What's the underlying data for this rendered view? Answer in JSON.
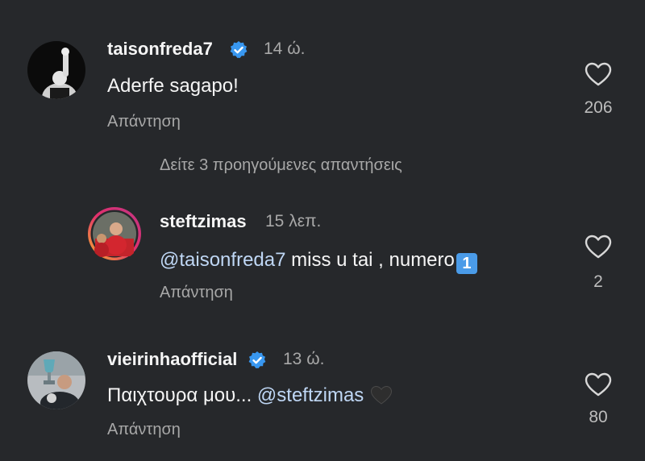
{
  "colors": {
    "background": "#26282b",
    "verified_blue": "#3897f0",
    "mention": "#bfd7f5",
    "secondary_text": "#a8a8a8"
  },
  "comments": [
    {
      "username": "taisonfreda7",
      "verified": true,
      "time": "14 ώ.",
      "text": "Aderfe sagapo!",
      "reply_label": "Απάντηση",
      "likes": "206",
      "avatar": "avatar-raised-fist-bw"
    },
    {
      "username": "steftzimas",
      "verified": false,
      "time": "15 λεπ.",
      "mention": "@taisonfreda7",
      "text": " miss u tai , numero",
      "emoji": "1",
      "emoji_name": "keycap-one-emoji",
      "reply_label": "Απάντηση",
      "likes": "2",
      "avatar": "avatar-red-jersey-story-ring"
    },
    {
      "username": "vieirinhaofficial",
      "verified": true,
      "time": "13 ώ.",
      "text": "Παιχτουρα μου... ",
      "mention": "@steftzimas",
      "emoji_name": "black-heart-emoji",
      "reply_label": "Απάντηση",
      "likes": "80",
      "avatar": "avatar-trophy"
    }
  ],
  "view_replies": "Δείτε 3 προηγούμενες απαντήσεις"
}
